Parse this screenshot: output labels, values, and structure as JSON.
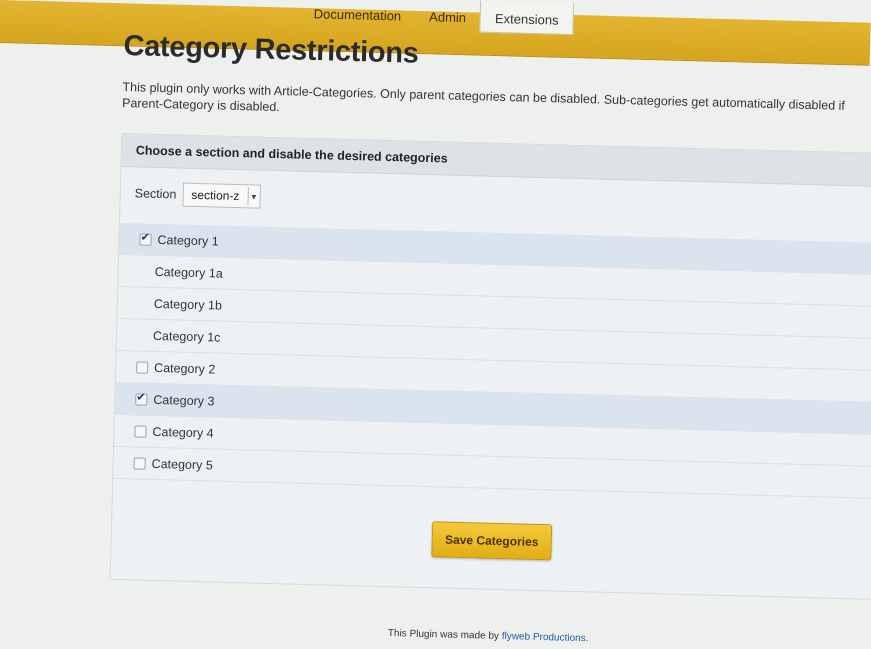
{
  "nav": {
    "items": [
      {
        "label": "Documentation"
      },
      {
        "label": "Admin"
      },
      {
        "label": "Extensions"
      }
    ]
  },
  "page": {
    "title": "Category Restrictions",
    "intro": "This plugin only works with Article-Categories. Only parent categories can be disabled. Sub-categories get automatically disabled if Parent-Category is disabled."
  },
  "panel": {
    "heading": "Choose a section and disable the desired categories",
    "section_label": "Section",
    "section_value": "section-z",
    "categories": [
      {
        "label": "Category 1",
        "checked": true,
        "sub": false
      },
      {
        "label": "Category 1a",
        "checked": false,
        "sub": true
      },
      {
        "label": "Category 1b",
        "checked": false,
        "sub": true
      },
      {
        "label": "Category 1c",
        "checked": false,
        "sub": true
      },
      {
        "label": "Category 2",
        "checked": false,
        "sub": false
      },
      {
        "label": "Category 3",
        "checked": true,
        "sub": false
      },
      {
        "label": "Category 4",
        "checked": false,
        "sub": false
      },
      {
        "label": "Category 5",
        "checked": false,
        "sub": false
      }
    ],
    "save_label": "Save Categories"
  },
  "footer": {
    "prefix": "This Plugin was made by ",
    "link": "flyweb Productions",
    "suffix": "."
  },
  "colors": {
    "accent": "#e2ad15",
    "selected_row": "#d9e4ee",
    "link": "#2657a5"
  }
}
